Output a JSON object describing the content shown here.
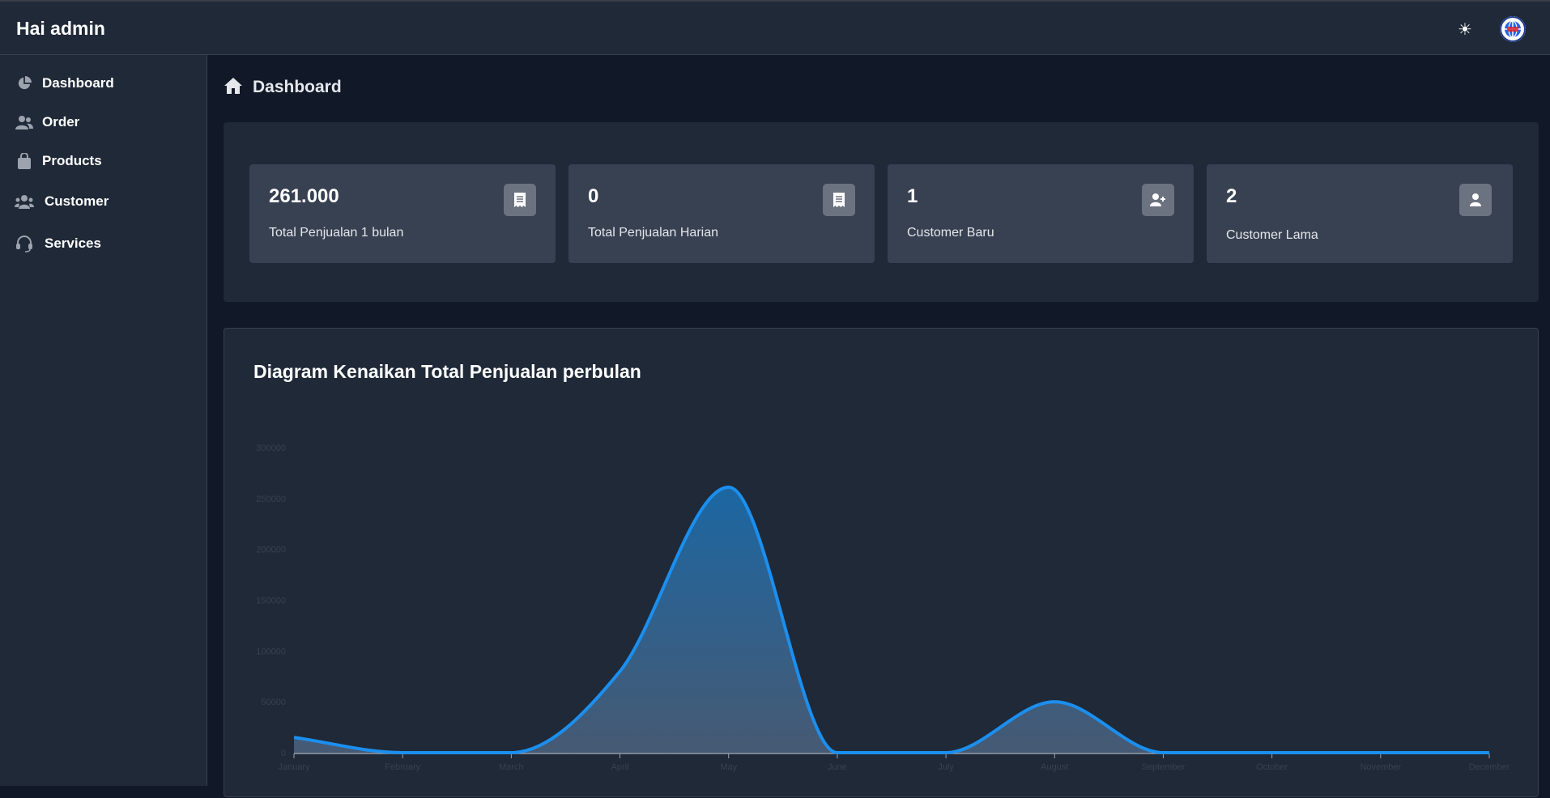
{
  "header": {
    "greeting": "Hai admin",
    "theme_icon": "sun-icon",
    "avatar_icon": "globe-avatar-icon"
  },
  "sidebar": {
    "items": [
      {
        "label": "Dashboard",
        "icon": "pie-chart-icon"
      },
      {
        "label": "Order",
        "icon": "users-icon"
      },
      {
        "label": "Products",
        "icon": "shopping-bag-icon"
      },
      {
        "label": "Customer",
        "icon": "user-group-icon"
      },
      {
        "label": "Services",
        "icon": "headset-icon"
      }
    ]
  },
  "breadcrumb": {
    "icon": "home-icon",
    "label": "Dashboard"
  },
  "stats": [
    {
      "value": "261.000",
      "label": "Total Penjualan 1 bulan",
      "icon": "receipt-icon"
    },
    {
      "value": "0",
      "label": "Total Penjualan Harian",
      "icon": "receipt-icon"
    },
    {
      "value": "1",
      "label": "Customer Baru",
      "icon": "user-plus-icon"
    },
    {
      "value": "2",
      "label": "Customer Lama",
      "icon": "user-icon"
    }
  ],
  "chart_panel": {
    "title": "Diagram Kenaikan Total Penjualan perbulan"
  },
  "colors": {
    "accent": "#1b8fef",
    "background": "#111827",
    "panel": "#1f2937",
    "card": "#374151"
  },
  "chart_data": {
    "type": "area",
    "title": "Diagram Kenaikan Total Penjualan perbulan",
    "categories": [
      "January",
      "February",
      "March",
      "April",
      "May",
      "June",
      "July",
      "August",
      "September",
      "October",
      "November",
      "December"
    ],
    "series": [
      {
        "values": [
          15000,
          0,
          0,
          80000,
          261000,
          0,
          0,
          50000,
          0,
          0,
          0,
          0
        ]
      }
    ],
    "yticks": [
      "0",
      "50000",
      "100000",
      "150000",
      "200000",
      "250000",
      "300000"
    ],
    "ylim": [
      0,
      300000
    ],
    "grid": false,
    "legend": "none"
  }
}
